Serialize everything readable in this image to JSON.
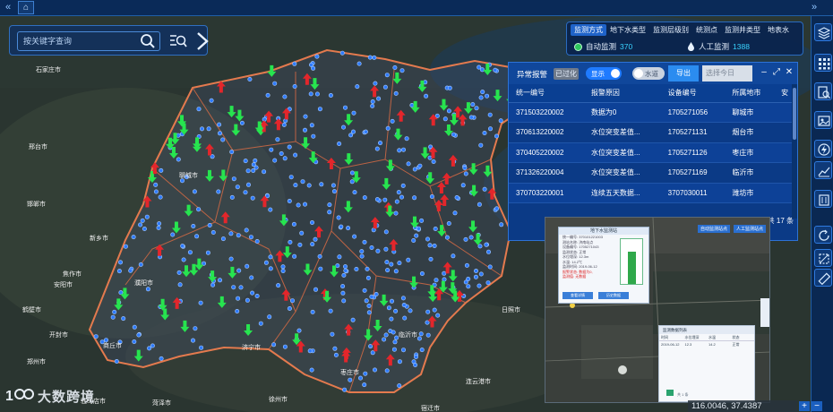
{
  "search": {
    "placeholder": "按关键字查询"
  },
  "monitor": {
    "tabs": [
      "监测方式",
      "地下水类型",
      "监测层级别",
      "统测点",
      "监测井类型",
      "地表水"
    ],
    "active_tab": "监测方式",
    "auto_label": "自动监测",
    "auto_count": "370",
    "manual_label": "人工监测",
    "manual_count": "1388"
  },
  "alarm": {
    "title": "异常报警",
    "subtitle": "已过化",
    "show_label": "显示",
    "water_label": "水道",
    "export_label": "导出",
    "date_placeholder": "选择今日",
    "columns": [
      "统一编号",
      "报警原因",
      "设备编号",
      "所属地市",
      "安"
    ],
    "rows": [
      [
        "371503220002",
        "数据为0",
        "1705271056",
        "聊城市"
      ],
      [
        "370613220002",
        "水位突变差值...",
        "1705271131",
        "烟台市"
      ],
      [
        "370405220002",
        "水位突变差值...",
        "1705271126",
        "枣庄市"
      ],
      [
        "371326220004",
        "水位突变差值...",
        "1705271169",
        "临沂市"
      ],
      [
        "370703220001",
        "连续五天数据...",
        "3707030011",
        "潍坊市"
      ]
    ],
    "footer": "共 17 条"
  },
  "map_labels": [
    {
      "text": "石家庄市"
    },
    {
      "text": "邢台市"
    },
    {
      "text": "邯郸市"
    },
    {
      "text": "安阳市"
    },
    {
      "text": "鹤壁市"
    },
    {
      "text": "开封市"
    },
    {
      "text": "郑州市"
    },
    {
      "text": "商丘市"
    },
    {
      "text": "菏泽市"
    },
    {
      "text": "临沂市"
    },
    {
      "text": "连云港市"
    },
    {
      "text": "宿迁市"
    },
    {
      "text": "日照市"
    },
    {
      "text": "枣庄市"
    },
    {
      "text": "济宁市"
    },
    {
      "text": "徐州市"
    },
    {
      "text": "濮阳市"
    },
    {
      "text": "新乡市"
    },
    {
      "text": "焦作市"
    },
    {
      "text": "聊城市"
    },
    {
      "text": "驻马店市"
    }
  ],
  "inset": {
    "tabs": [
      "自动监测站点",
      "人工监测站点"
    ],
    "popup_title": "地下水监测站",
    "popup_lines": [
      "统一编号: 370101221003",
      "测站名称: 济南站点",
      "设备编号: 1705271043",
      "监测状态: 正常",
      "水位埋深: 12.3m",
      "水温: 14.2℃",
      "监测时间: 2019-06-12",
      "报警状态: 数据为0,"
    ],
    "popup_alert": "监测值: 无数据",
    "btn_left": "查看详情",
    "btn_right": "历史数据",
    "table_title": "监测数据列表",
    "table_cols": [
      "时间",
      "水位埋深",
      "水温",
      "状态"
    ],
    "table_rows": [
      [
        "2019-06-12",
        "12.3",
        "14.2",
        "正常"
      ]
    ],
    "table_footer": "共 1 条"
  },
  "coord": "116.0046, 37.4387",
  "brand": "大数跨境",
  "colors": {
    "accent": "#2b8cf0",
    "alarm_up": "#e3262b",
    "normal_down": "#27e44f",
    "station": "#2f7bff"
  }
}
